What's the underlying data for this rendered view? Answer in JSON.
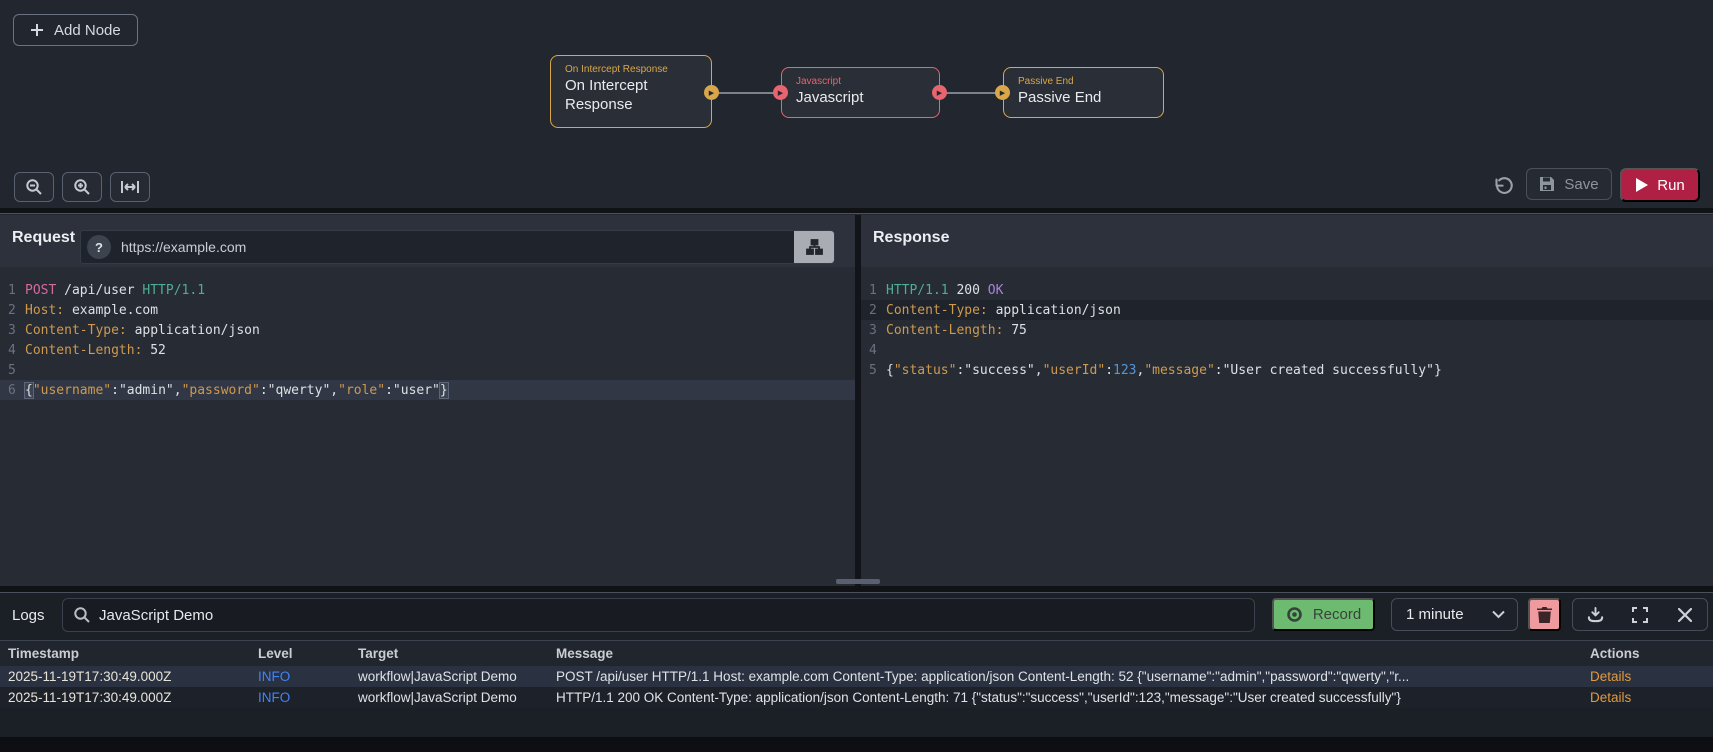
{
  "workflow": {
    "add_node": "Add Node",
    "nodes": [
      {
        "type": "On Intercept Response",
        "name": "On Intercept Response"
      },
      {
        "type": "Javascript",
        "name": "Javascript"
      },
      {
        "type": "Passive End",
        "name": "Passive End"
      }
    ],
    "save": "Save",
    "run": "Run"
  },
  "request": {
    "title": "Request",
    "url": "https://example.com",
    "lines": [
      {
        "n": "1",
        "s": [
          {
            "t": "POST",
            "y": "method"
          },
          {
            "t": " /api/user ",
            "y": "plain"
          },
          {
            "t": "HTTP/1.1",
            "y": "version"
          }
        ]
      },
      {
        "n": "2",
        "s": [
          {
            "t": "Host:",
            "y": "hname"
          },
          {
            "t": " example.com",
            "y": "plain"
          }
        ]
      },
      {
        "n": "3",
        "s": [
          {
            "t": "Content-Type:",
            "y": "hname"
          },
          {
            "t": " application/json",
            "y": "plain"
          }
        ]
      },
      {
        "n": "4",
        "s": [
          {
            "t": "Content-Length:",
            "y": "hname"
          },
          {
            "t": " 52",
            "y": "plain"
          }
        ]
      },
      {
        "n": "5",
        "s": []
      },
      {
        "n": "6",
        "hl": "active",
        "s": [
          {
            "t": "{",
            "y": "brkt"
          },
          {
            "t": "\"username\"",
            "y": "key"
          },
          {
            "t": ":",
            "y": "plain"
          },
          {
            "t": "\"admin\"",
            "y": "str"
          },
          {
            "t": ",",
            "y": "plain"
          },
          {
            "t": "\"password\"",
            "y": "key"
          },
          {
            "t": ":",
            "y": "plain"
          },
          {
            "t": "\"qwerty\"",
            "y": "str"
          },
          {
            "t": ",",
            "y": "plain"
          },
          {
            "t": "\"role\"",
            "y": "key"
          },
          {
            "t": ":",
            "y": "plain"
          },
          {
            "t": "\"user\"",
            "y": "str"
          },
          {
            "t": "}",
            "y": "brkt"
          }
        ]
      }
    ]
  },
  "response": {
    "title": "Response",
    "lines": [
      {
        "n": "1",
        "s": [
          {
            "t": "HTTP/1.1",
            "y": "version"
          },
          {
            "t": " 200 ",
            "y": "plain"
          },
          {
            "t": "OK",
            "y": "ok"
          }
        ]
      },
      {
        "n": "2",
        "hl": "dim",
        "s": [
          {
            "t": "Content-Type:",
            "y": "hname"
          },
          {
            "t": " application/json",
            "y": "plain"
          }
        ]
      },
      {
        "n": "3",
        "s": [
          {
            "t": "Content-Length:",
            "y": "hname"
          },
          {
            "t": " 75",
            "y": "plain"
          }
        ]
      },
      {
        "n": "4",
        "s": []
      },
      {
        "n": "5",
        "s": [
          {
            "t": "{",
            "y": "plain"
          },
          {
            "t": "\"status\"",
            "y": "key"
          },
          {
            "t": ":",
            "y": "plain"
          },
          {
            "t": "\"success\"",
            "y": "str"
          },
          {
            "t": ",",
            "y": "plain"
          },
          {
            "t": "\"userId\"",
            "y": "key"
          },
          {
            "t": ":",
            "y": "plain"
          },
          {
            "t": "123",
            "y": "num"
          },
          {
            "t": ",",
            "y": "plain"
          },
          {
            "t": "\"message\"",
            "y": "key"
          },
          {
            "t": ":",
            "y": "plain"
          },
          {
            "t": "\"User created successfully\"",
            "y": "str"
          },
          {
            "t": "}",
            "y": "plain"
          }
        ]
      }
    ]
  },
  "logs": {
    "title": "Logs",
    "search_value": "JavaScript Demo",
    "record": "Record",
    "interval": "1 minute",
    "table": {
      "headers": [
        "Timestamp",
        "Level",
        "Target",
        "Message",
        "Actions"
      ],
      "rows": [
        {
          "timestamp": "2025-11-19T17:30:49.000Z",
          "level": "INFO",
          "target": "workflow|JavaScript Demo",
          "message": "POST /api/user HTTP/1.1 Host: example.com Content-Type: application/json Content-Length: 52 {\"username\":\"admin\",\"password\":\"qwerty\",\"r...",
          "action": "Details"
        },
        {
          "timestamp": "2025-11-19T17:30:49.000Z",
          "level": "INFO",
          "target": "workflow|JavaScript Demo",
          "message": "HTTP/1.1 200 OK Content-Type: application/json Content-Length: 71 {\"status\":\"success\",\"userId\":123,\"message\":\"User created successfully\"}",
          "action": "Details"
        }
      ]
    }
  },
  "colors": {
    "accent_amber": "#d9a74a",
    "node_red": "#e8646f",
    "run_red": "#b02045",
    "record_green": "#6dbb71",
    "trash_pink": "#ef9a9e",
    "info_blue": "#4083f7",
    "details_orange": "#e09b3e"
  }
}
